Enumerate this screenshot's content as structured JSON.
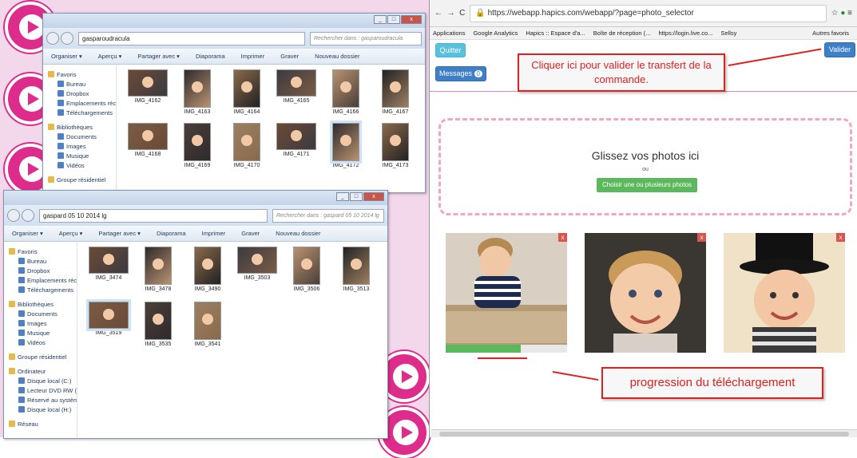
{
  "win1": {
    "path": "gasparoudracula",
    "search": "Rechercher dans : gasparoudracula",
    "toolbar": [
      "Organiser ▾",
      "Aperçu ▾",
      "Partager avec ▾",
      "Diaporama",
      "Imprimer",
      "Graver",
      "Nouveau dossier"
    ],
    "sidebar": [
      {
        "label": "Favoris",
        "head": true
      },
      {
        "label": "Bureau"
      },
      {
        "label": "Dropbox"
      },
      {
        "label": "Emplacements récents"
      },
      {
        "label": "Téléchargements"
      },
      {
        "label": "Bibliothèques",
        "head": true
      },
      {
        "label": "Documents"
      },
      {
        "label": "Images"
      },
      {
        "label": "Musique"
      },
      {
        "label": "Vidéos"
      },
      {
        "label": "Groupe résidentiel",
        "head": true
      }
    ],
    "files": [
      "IMG_4162",
      "IMG_4163",
      "IMG_4164",
      "IMG_4165",
      "IMG_4166",
      "IMG_4167",
      "IMG_4168",
      "IMG_4169",
      "IMG_4170",
      "IMG_4171",
      "IMG_4172",
      "IMG_4173"
    ]
  },
  "win2": {
    "path": "gaspard 05 10 2014 lg",
    "search": "Rechercher dans : gaspard 05 10 2014 lg",
    "toolbar": [
      "Organiser ▾",
      "Aperçu ▾",
      "Partager avec ▾",
      "Diaporama",
      "Imprimer",
      "Graver",
      "Nouveau dossier"
    ],
    "sidebar": [
      {
        "label": "Favoris",
        "head": true
      },
      {
        "label": "Bureau"
      },
      {
        "label": "Dropbox"
      },
      {
        "label": "Emplacements récents"
      },
      {
        "label": "Téléchargements"
      },
      {
        "label": "Bibliothèques",
        "head": true
      },
      {
        "label": "Documents"
      },
      {
        "label": "Images"
      },
      {
        "label": "Musique"
      },
      {
        "label": "Vidéos"
      },
      {
        "label": "Groupe résidentiel",
        "head": true
      },
      {
        "label": "Ordinateur",
        "head": true
      },
      {
        "label": "Disque local (C:)"
      },
      {
        "label": "Lecteur DVD RW (D:)"
      },
      {
        "label": "Réservé au système"
      },
      {
        "label": "Disque local (H:)"
      },
      {
        "label": "Réseau",
        "head": true
      }
    ],
    "files": [
      "IMG_3474",
      "IMG_3478",
      "IMG_3490",
      "IMG_3503",
      "IMG_3506",
      "IMG_3513",
      "IMG_3519",
      "IMG_3535",
      "IMG_3541"
    ]
  },
  "browser": {
    "url": "https://webapp.hapics.com/webapp/?page=photo_selector",
    "bookmarks": [
      "Applications",
      "Google Analytics",
      "Hapics :: Espace d'a...",
      "Boîte de réception (...",
      "https://login.live.co...",
      "Sellsy",
      "Autres favoris"
    ]
  },
  "app": {
    "quit": "Quitter",
    "messages": "Messages",
    "messages_count": "0",
    "validate": "Valider",
    "callout_validate": "Cliquer ici pour valider le transfert de la commande.",
    "drop_title": "Glissez vos photos ici",
    "drop_or": "ou",
    "choose": "Choisir une ou plusieurs photos",
    "callout_progress": "progression du téléchargement",
    "remove": "x",
    "progress": 0.62
  },
  "colors": {
    "pink": "#dd2c8c",
    "bootstrap_blue": "#3f7fc8",
    "green": "#5cb85c",
    "red": "#e02020"
  }
}
